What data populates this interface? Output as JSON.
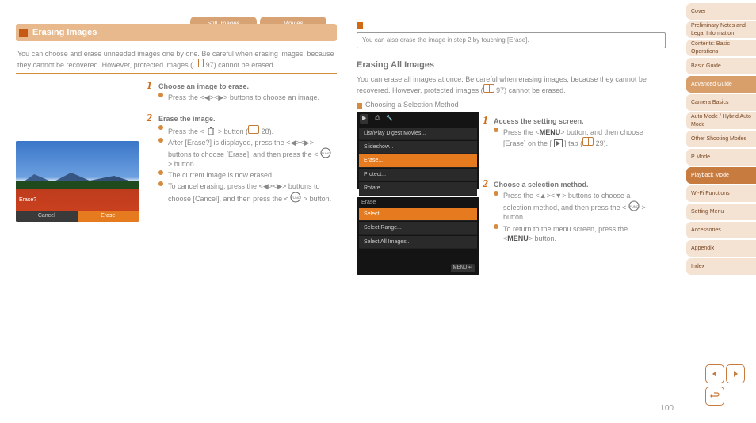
{
  "sidebar": {
    "items": [
      {
        "label": "Cover"
      },
      {
        "label": "Preliminary Notes and Legal Information"
      },
      {
        "label": "Contents: Basic Operations"
      },
      {
        "label": "Basic Guide"
      },
      {
        "label": "Advanced Guide"
      },
      {
        "label": "Camera Basics"
      },
      {
        "label": "Auto Mode / Hybrid Auto Mode"
      },
      {
        "label": "Other Shooting Modes"
      },
      {
        "label": "P Mode"
      },
      {
        "label": "Playback Mode"
      },
      {
        "label": "Wi-Fi Functions"
      },
      {
        "label": "Setting Menu"
      },
      {
        "label": "Accessories"
      },
      {
        "label": "Appendix"
      },
      {
        "label": "Index"
      }
    ],
    "dark_idx": [
      4
    ],
    "curr_idx": [
      9
    ]
  },
  "top_tabs": [
    "Still Images",
    "Movies"
  ],
  "left": {
    "title": "Erasing Images",
    "lead_pre": "You can choose and erase unneeded images one by one. Be careful when erasing images, because they cannot be recovered. However, protected images (",
    "lead_ref": "97",
    "lead_post": ") cannot be erased.",
    "step1": {
      "n": "1",
      "h": "Choose an image to erase.",
      "b": "Press the <◀><▶> buttons to choose an image."
    },
    "step2": {
      "n": "2",
      "h": "Erase the image.",
      "b1_pre": "Press the <",
      "b1_post": "> button (",
      "b1_ref": "28",
      "b1_end": ").",
      "b2_pre": "After [Erase?] is displayed, press the <◀><▶> buttons to choose [Erase], and then press the <",
      "b2_post": "> button.",
      "b3": "The current image is now erased.",
      "b4_pre": "To cancel erasing, press the <◀><▶> buttons to choose [Cancel], and then press the <",
      "b4_post": "> button."
    },
    "cam": {
      "q": "Erase?",
      "cancel": "Cancel",
      "erase": "Erase"
    }
  },
  "right": {
    "tip": "You can also erase the image in step 2 by touching [Erase].",
    "warn_pre": "Be careful when erasing images, because they cannot be recovered. However, protected images (",
    "warn_ref": "97",
    "warn_post": ") cannot be erased.",
    "all_title": "Erasing All Images",
    "all_body": "You can erase all images at once.",
    "sub": "Choosing a Selection Method",
    "menu1": {
      "items": [
        "List/Play Digest Movies...",
        "Slideshow...",
        "Erase...",
        "Protect...",
        "Rotate..."
      ],
      "sel": 2
    },
    "menu2": {
      "title": "Erase",
      "items": [
        "Select...",
        "Select Range...",
        "Select All Images..."
      ],
      "sel": 0,
      "ret": "MENU"
    },
    "step1": {
      "n": "1",
      "h": "Access the setting screen.",
      "b_pre": "Press the <",
      "menu": "MENU",
      "b_mid": "> button, and then choose [Erase] on the [",
      "b_post": "] tab (",
      "ref": "29",
      "end": ")."
    },
    "step2": {
      "n": "2",
      "h": "Choose a selection method.",
      "b1_pre": "Press the <▲><▼> buttons to choose a selection method, and then press the <",
      "b1_post": "> button.",
      "b2_pre": "To return to the menu screen, press the <",
      "menu": "MENU",
      "b2_post": "> button."
    }
  },
  "page_no": "100"
}
